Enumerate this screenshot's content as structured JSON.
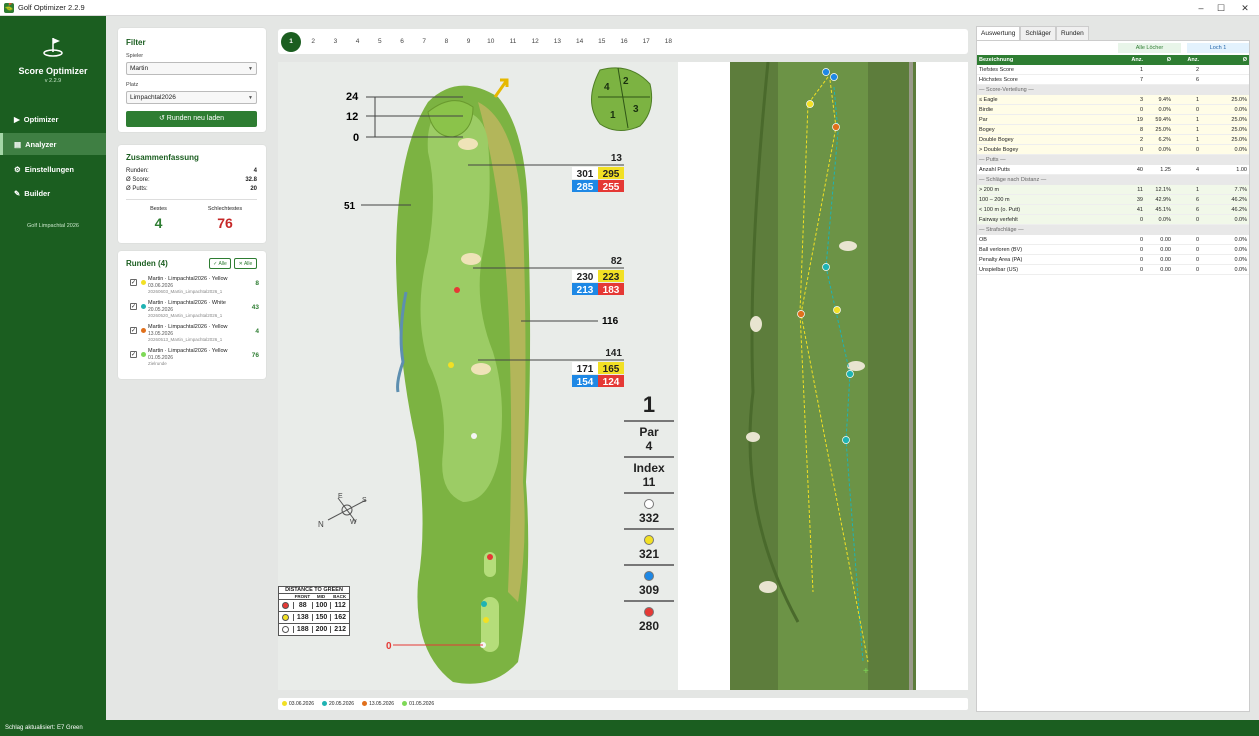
{
  "window": {
    "title": "Golf Optimizer  2.2.9"
  },
  "app": {
    "name": "Score Optimizer",
    "version": "v 2.2.9"
  },
  "nav": [
    {
      "label": "Optimizer",
      "icon": "play-icon"
    },
    {
      "label": "Analyzer",
      "icon": "chart-icon"
    },
    {
      "label": "Einstellungen",
      "icon": "gear-icon"
    },
    {
      "label": "Builder",
      "icon": "wrench-icon"
    }
  ],
  "nav_sub": "Golf Limpachtal 2026",
  "filter": {
    "title": "Filter",
    "spieler_label": "Spieler",
    "spieler": "Martin",
    "platz_label": "Platz",
    "platz": "Limpachtal2026",
    "reload": "↺ Runden neu laden"
  },
  "summary": {
    "title": "Zusammenfassung",
    "rows": [
      {
        "label": "Runden:",
        "value": "4"
      },
      {
        "label": "Ø Score:",
        "value": "32.8"
      },
      {
        "label": "Ø Putts:",
        "value": "20"
      }
    ],
    "best_label": "Bestes",
    "best": "4",
    "worst_label": "Schlechtestes",
    "worst": "76"
  },
  "rounds": {
    "title": "Runden (4)",
    "btn_all": "✓ Alle",
    "btn_none": "✕ Alle",
    "items": [
      {
        "title": "Martin  ·  Limpachtal2026  ·  Yellow",
        "date": "03.06.2026",
        "file": "20260603_Martin_Limpachtal2026_1",
        "score": "8",
        "color": "#f2e024"
      },
      {
        "title": "Martin  ·  Limpachtal2026  ·  White",
        "date": "20.05.2026",
        "file": "20260520_Martin_Limpachtal2026_1",
        "score": "43",
        "color": "#1fb3b3"
      },
      {
        "title": "Martin  ·  Limpachtal2026  ·  Yellow",
        "date": "13.05.2026",
        "file": "20260513_Martin_Limpachtal2026_1",
        "score": "4",
        "color": "#e0701c"
      },
      {
        "title": "Martin  ·  Limpachtal2026  ·  Yellow",
        "date": "01.05.2026",
        "file": "Zielrunde",
        "score": "76",
        "color": "#7ed957"
      }
    ]
  },
  "holes": [
    "1",
    "2",
    "3",
    "4",
    "5",
    "6",
    "7",
    "8",
    "9",
    "10",
    "11",
    "12",
    "13",
    "14",
    "15",
    "16",
    "17",
    "18"
  ],
  "hole": {
    "number": "1",
    "par_label": "Par",
    "par": "4",
    "index_label": "Index",
    "index": "11",
    "tees": [
      {
        "color": "#ffffff",
        "len": "332"
      },
      {
        "color": "#f2e024",
        "len": "321"
      },
      {
        "color": "#1e88e5",
        "len": "309"
      },
      {
        "color": "#e53935",
        "len": "280"
      }
    ],
    "green_marks": [
      "24",
      "12",
      "0"
    ],
    "left_mark": "51",
    "mid_mark": "116",
    "red_zero": "0",
    "blocks": [
      {
        "top": "13",
        "a": "301",
        "b": "295",
        "c": "285",
        "d": "255"
      },
      {
        "top": "82",
        "a": "230",
        "b": "223",
        "c": "213",
        "d": "183"
      },
      {
        "top": "141",
        "a": "171",
        "b": "165",
        "c": "154",
        "d": "124"
      }
    ],
    "green_sections": [
      "4",
      "2",
      "1",
      "3"
    ],
    "dtg": {
      "title": "DISTANCE TO GREEN",
      "cols": [
        "FRONT",
        "MID",
        "BACK"
      ],
      "rows": [
        {
          "c": "#e53935",
          "v": [
            "88",
            "100",
            "112"
          ]
        },
        {
          "c": "#f2e024",
          "v": [
            "138",
            "150",
            "162"
          ]
        },
        {
          "c": "#ffffff",
          "v": [
            "188",
            "200",
            "212"
          ]
        }
      ]
    },
    "compass": [
      "N",
      "E",
      "S",
      "W"
    ]
  },
  "legend": [
    "03.06.2026",
    "20.05.2026",
    "13.05.2026",
    "01.05.2026"
  ],
  "tabs": [
    "Auswertung",
    "Schläger",
    "Runden"
  ],
  "table": {
    "group_all": "Alle Löcher",
    "group_hole": "Loch 1",
    "header": [
      "Bezeichnung",
      "Anz.",
      "Ø",
      "Anz.",
      "Ø"
    ],
    "rows": [
      {
        "t": "r",
        "v": [
          "Tiefstes Score",
          "1",
          "",
          "2",
          ""
        ]
      },
      {
        "t": "r",
        "v": [
          "Höchstes Score",
          "7",
          "",
          "6",
          ""
        ]
      },
      {
        "t": "s",
        "v": [
          "— Score-Verteilung —"
        ]
      },
      {
        "t": "r",
        "v": [
          "≤ Eagle",
          "3",
          "9.4%",
          "1",
          "25.0%"
        ]
      },
      {
        "t": "r",
        "v": [
          "Birdie",
          "0",
          "0.0%",
          "0",
          "0.0%"
        ]
      },
      {
        "t": "r",
        "v": [
          "Par",
          "19",
          "59.4%",
          "1",
          "25.0%"
        ]
      },
      {
        "t": "r",
        "v": [
          "Bogey",
          "8",
          "25.0%",
          "1",
          "25.0%"
        ]
      },
      {
        "t": "r",
        "v": [
          "Double Bogey",
          "2",
          "6.2%",
          "1",
          "25.0%"
        ]
      },
      {
        "t": "r",
        "v": [
          "> Double Bogey",
          "0",
          "0.0%",
          "0",
          "0.0%"
        ]
      },
      {
        "t": "s",
        "v": [
          "— Putts —"
        ]
      },
      {
        "t": "r",
        "v": [
          "Anzahl Putts",
          "40",
          "1.25",
          "4",
          "1.00"
        ]
      },
      {
        "t": "s",
        "v": [
          "— Schläge nach Distanz —"
        ]
      },
      {
        "t": "r",
        "v": [
          "> 200 m",
          "11",
          "12.1%",
          "1",
          "7.7%"
        ]
      },
      {
        "t": "r",
        "v": [
          "100 – 200 m",
          "39",
          "42.9%",
          "6",
          "46.2%"
        ]
      },
      {
        "t": "r",
        "v": [
          "< 100 m (o. Putt)",
          "41",
          "45.1%",
          "6",
          "46.2%"
        ]
      },
      {
        "t": "r",
        "v": [
          "Fairway verfehlt",
          "0",
          "0.0%",
          "0",
          "0.0%"
        ]
      },
      {
        "t": "s",
        "v": [
          "— Strafschläge —"
        ]
      },
      {
        "t": "r",
        "v": [
          "OB",
          "0",
          "0.00",
          "0",
          "0.0%"
        ]
      },
      {
        "t": "r",
        "v": [
          "Ball verloren (BV)",
          "0",
          "0.00",
          "0",
          "0.0%"
        ]
      },
      {
        "t": "r",
        "v": [
          "Penalty Area (PA)",
          "0",
          "0.00",
          "0",
          "0.0%"
        ]
      },
      {
        "t": "r",
        "v": [
          "Unspielbar (US)",
          "0",
          "0.00",
          "0",
          "0.0%"
        ]
      }
    ]
  },
  "status": "Schlag aktualisiert: E7  Green"
}
